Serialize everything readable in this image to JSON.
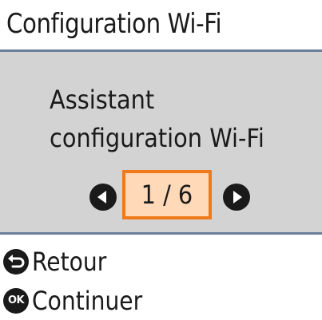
{
  "header": {
    "title": "Configuration Wi-Fi"
  },
  "panel": {
    "line1": "Assistant",
    "line2": "configuration Wi-Fi"
  },
  "pager": {
    "indicator": "1 / 6",
    "prev_icon": "arrow-left-circle-icon",
    "next_icon": "arrow-right-circle-icon"
  },
  "actions": {
    "back_label": "Retour",
    "back_icon": "return-icon",
    "continue_label": "Continuer",
    "continue_icon_text": "OK"
  },
  "colors": {
    "panel_bg": "#d3d3d3",
    "divider": "#6a7f98",
    "highlight_fill": "#ffd9b8",
    "highlight_border": "#f07a1a"
  }
}
